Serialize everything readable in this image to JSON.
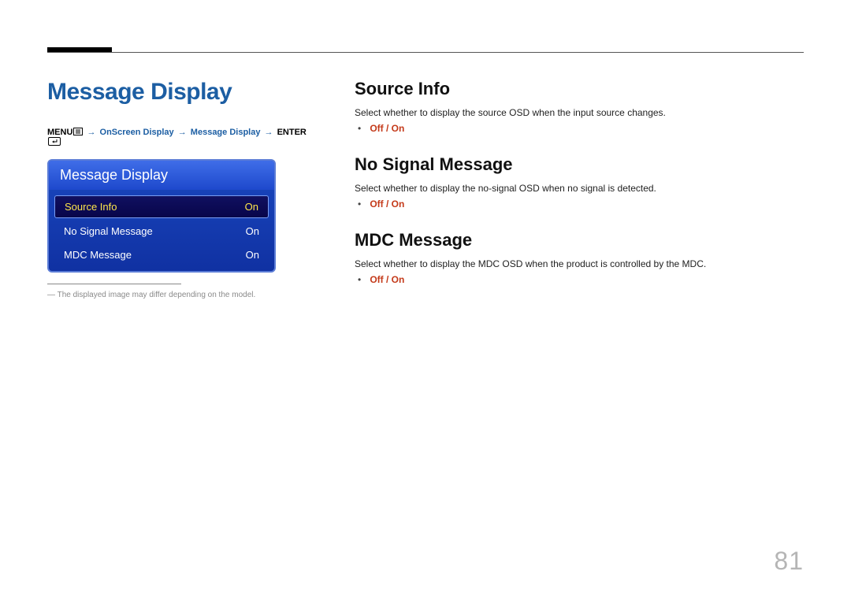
{
  "page": {
    "title": "Message Display",
    "number": "81",
    "disclaimer": "The displayed image may differ depending on the model."
  },
  "breadcrumb": {
    "menu_label": "MENU",
    "steps": [
      "OnScreen Display",
      "Message Display"
    ],
    "enter_label": "ENTER"
  },
  "osd": {
    "header": "Message Display",
    "items": [
      {
        "label": "Source Info",
        "value": "On",
        "selected": true
      },
      {
        "label": "No Signal Message",
        "value": "On",
        "selected": false
      },
      {
        "label": "MDC Message",
        "value": "On",
        "selected": false
      }
    ]
  },
  "sections": [
    {
      "heading": "Source Info",
      "desc": "Select whether to display the source OSD when the input source changes.",
      "options": "Off / On"
    },
    {
      "heading": "No Signal Message",
      "desc": "Select whether to display the no-signal OSD when no signal is detected.",
      "options": "Off / On"
    },
    {
      "heading": "MDC Message",
      "desc": "Select whether to display the MDC OSD when the product is controlled by the MDC.",
      "options": "Off / On"
    }
  ]
}
